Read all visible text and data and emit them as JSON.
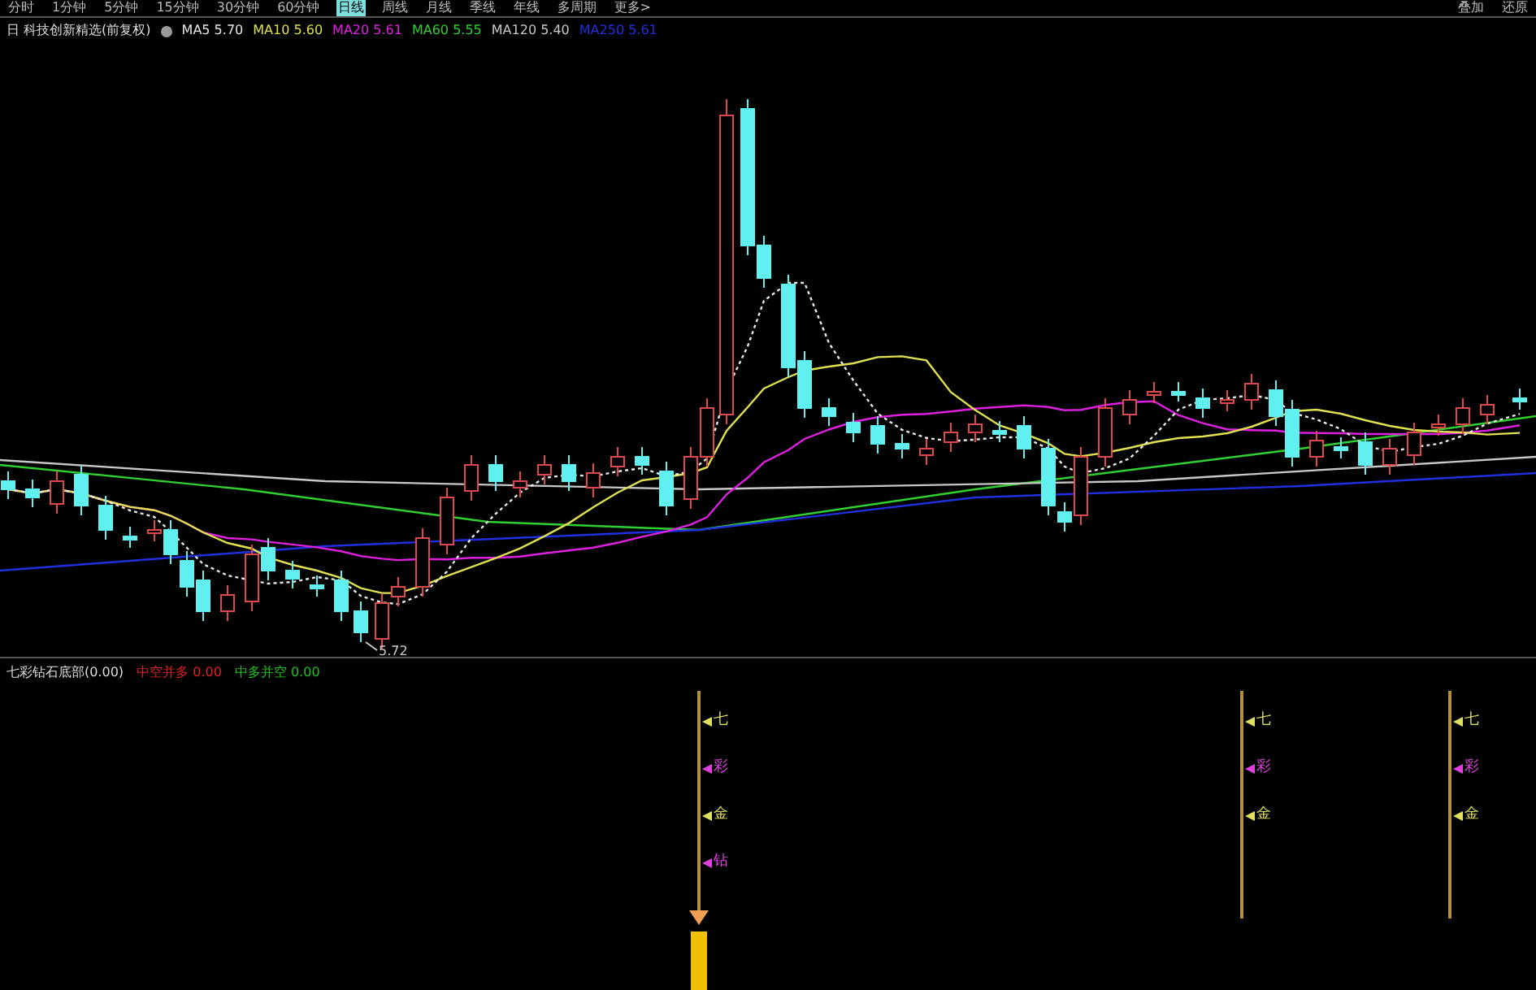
{
  "toolbar": {
    "periods": [
      {
        "label": "分时",
        "selected": false
      },
      {
        "label": "1分钟",
        "selected": false
      },
      {
        "label": "5分钟",
        "selected": false
      },
      {
        "label": "15分钟",
        "selected": false
      },
      {
        "label": "30分钟",
        "selected": false
      },
      {
        "label": "60分钟",
        "selected": false
      },
      {
        "label": "日线",
        "selected": true
      },
      {
        "label": "周线",
        "selected": false
      },
      {
        "label": "月线",
        "selected": false
      },
      {
        "label": "季线",
        "selected": false
      },
      {
        "label": "年线",
        "selected": false
      },
      {
        "label": "多周期",
        "selected": false
      },
      {
        "label": "更多>",
        "selected": false
      }
    ],
    "right_buttons": [
      "叠加",
      "还原"
    ]
  },
  "main_legend": {
    "title": "日 科技创新精选(前复权)",
    "averages": [
      {
        "name": "MA5",
        "value": "5.70",
        "color": "#e8e8e8"
      },
      {
        "name": "MA10",
        "value": "5.60",
        "color": "#e0e050"
      },
      {
        "name": "MA20",
        "value": "5.61",
        "color": "#e020e0"
      },
      {
        "name": "MA60",
        "value": "5.55",
        "color": "#30d030"
      },
      {
        "name": "MA120",
        "value": "5.40",
        "color": "#c8c8c8"
      },
      {
        "name": "MA250",
        "value": "5.61",
        "color": "#2030e0"
      }
    ]
  },
  "low_price_label": "5.72",
  "sub_legend": {
    "title": "七彩钻石底部(0.00)",
    "items": [
      {
        "name": "中空并多",
        "value": "0.00",
        "color": "#e02020"
      },
      {
        "name": "中多并空",
        "value": "0.00",
        "color": "#20c020"
      }
    ]
  },
  "signals": [
    {
      "bar": true,
      "markers": [
        {
          "label": "七",
          "color": "#e0e060"
        },
        {
          "label": "彩",
          "color": "#e040e0"
        },
        {
          "label": "金",
          "color": "#e0e060"
        },
        {
          "label": "钻",
          "color": "#e040e0"
        }
      ]
    },
    {
      "bar": false,
      "markers": [
        {
          "label": "七",
          "color": "#e0e060"
        },
        {
          "label": "彩",
          "color": "#e040e0"
        },
        {
          "label": "金",
          "color": "#e0e060"
        }
      ]
    },
    {
      "bar": false,
      "markers": [
        {
          "label": "七",
          "color": "#e0e060"
        },
        {
          "label": "彩",
          "color": "#e040e0"
        },
        {
          "label": "金",
          "color": "#e0e060"
        }
      ]
    }
  ]
}
